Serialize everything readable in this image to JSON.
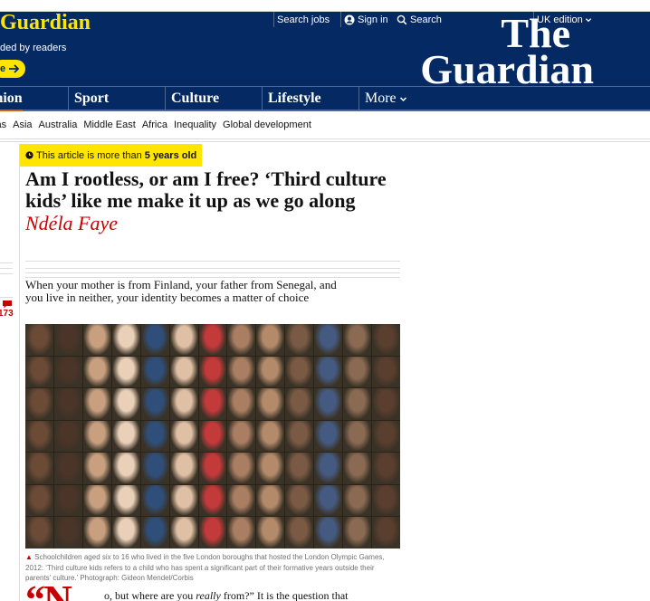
{
  "masthead": {
    "brand_fragment": "Guardian",
    "funded_text": "ded by readers",
    "support_label": "e",
    "logo_line1": "The",
    "logo_line2": "Guardian",
    "search_jobs": "Search jobs",
    "sign_in": "Sign in",
    "search": "Search",
    "edition": "UK edition",
    "bg_color": "#052962",
    "accent_color": "#ffe500"
  },
  "pillars": {
    "opinion": "inion",
    "sport": "Sport",
    "culture": "Culture",
    "lifestyle": "Lifestyle",
    "more": "More"
  },
  "subnav": [
    "cas",
    "Asia",
    "Australia",
    "Middle East",
    "Africa",
    "Inequality",
    "Global development"
  ],
  "article": {
    "age_prefix": "This article is more than",
    "age_value": "5 years old",
    "headline": "Am I rootless, or am I free? ‘Third culture kids’ like me make it up as we go along",
    "byline": "Ndéla Faye",
    "standfirst": "When your mother is from Finland, your father from Senegal, and you live in neither, your identity becomes a matter of choice",
    "caption": "Schoolchildren aged six to 16 who lived in the five London boroughs that hosted the London Olympic Games, 2012: ‘Third culture kids refers to a child who has spent a significant part of their formative years outside their parents’ culture.’ Photograph: Gideon Mendel/Corbis",
    "dropcap": "“N",
    "body_start": "o, but where are you",
    "body_em": "really",
    "body_end": "from?” It is the question that",
    "comment_count": "173",
    "pillar_color": "#c70000"
  },
  "photo": {
    "tile_colors": [
      "#6b4a36",
      "#a97e62",
      "#3a2a22",
      "#c49a7a",
      "#2f4f7a",
      "#8a6a52",
      "#d8b498",
      "#4b3428",
      "#b38a6a",
      "#1f2f4a",
      "#9c7458",
      "#e0c0a4",
      "#5a3e2e",
      "#3e6aa0",
      "#c8a080",
      "#7a5a44",
      "#2a1e18",
      "#b0876a",
      "#c33a3a",
      "#d6b090",
      "#64483a",
      "#ead0b8",
      "#445a80",
      "#9a6e52"
    ]
  }
}
